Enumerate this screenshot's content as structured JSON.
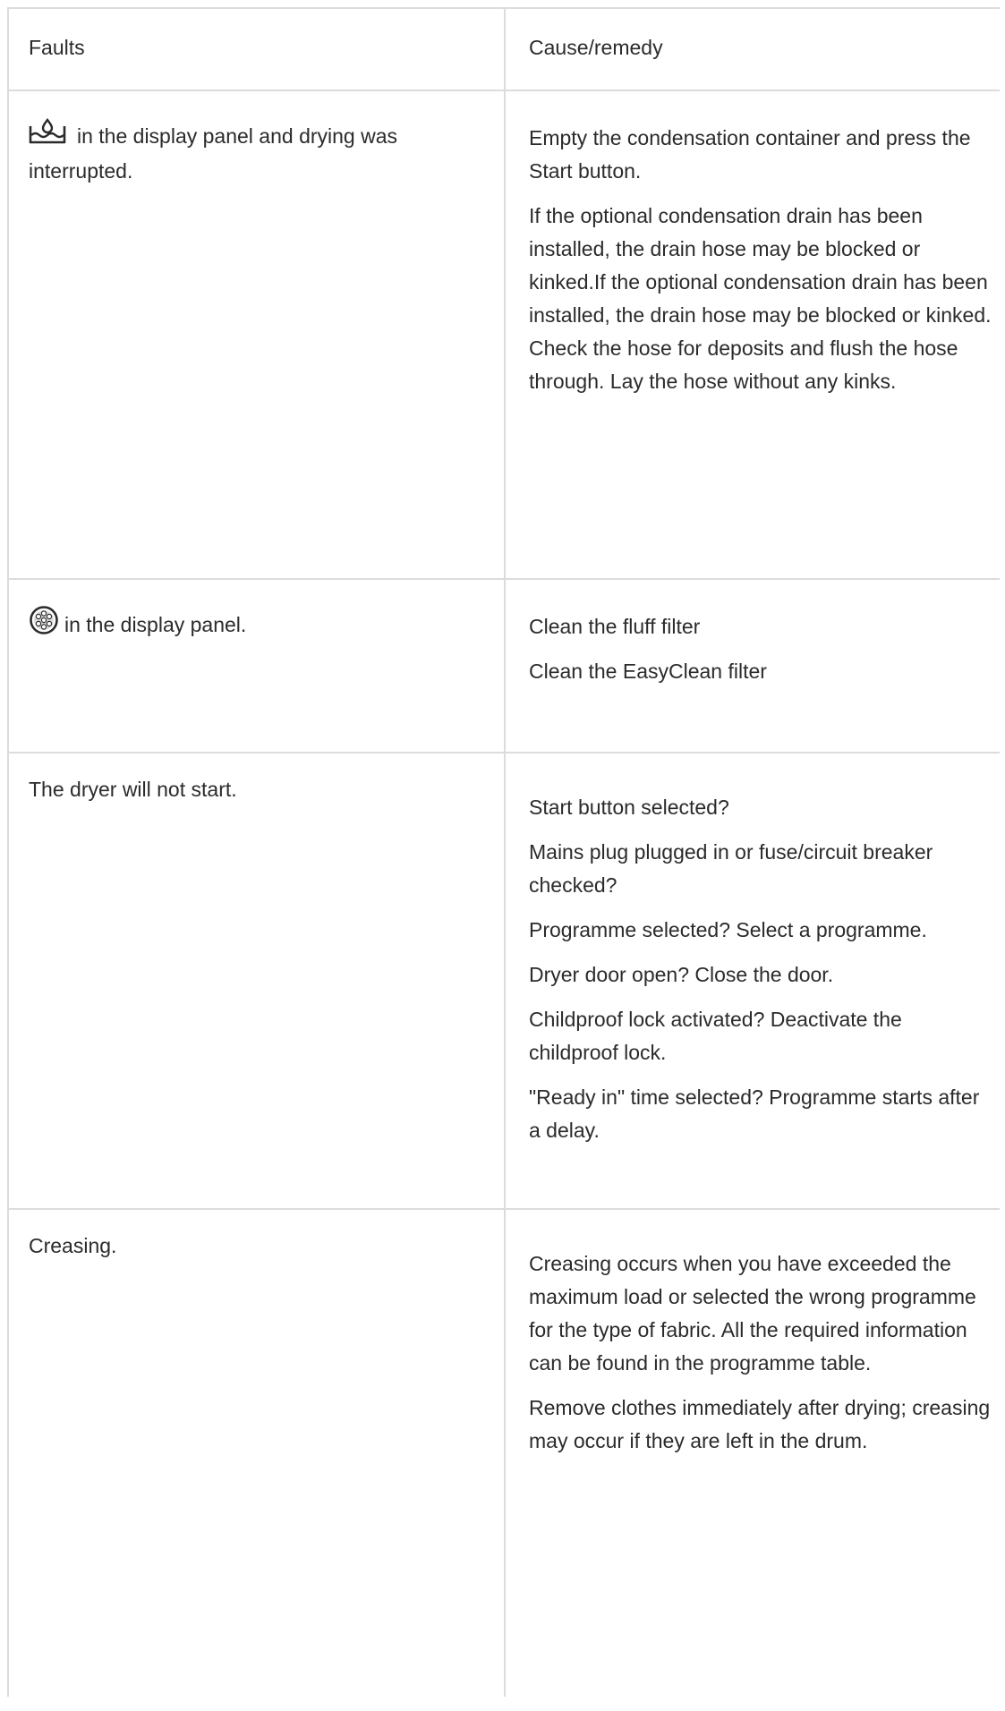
{
  "table": {
    "headers": {
      "fault": "Faults",
      "remedy": "Cause/remedy"
    },
    "rows": [
      {
        "fault_icon": "condensation-container-icon",
        "fault": "in the display panel and drying was interrupted.",
        "remedies": [
          "Empty the condensation container and press the Start button.",
          "If the optional condensation drain has been installed, the drain hose may be blocked or kinked.If the optional condensation drain has been installed, the drain hose may be blocked or kinked. Check the hose for deposits and flush the hose through. Lay the hose without any kinks."
        ]
      },
      {
        "fault_icon": "fluff-filter-icon",
        "fault": "in the display panel.",
        "remedies": [
          "Clean the fluff filter",
          "Clean the EasyClean filter"
        ]
      },
      {
        "fault": "The dryer will not start.",
        "remedies": [
          "Start button selected?",
          "Mains plug plugged in or fuse/circuit breaker checked?",
          "Programme selected? Select a programme.",
          "Dryer door open? Close the door.",
          "Childproof lock activated? Deactivate the childproof lock.",
          "\"Ready in\" time selected? Programme starts after a delay."
        ]
      },
      {
        "fault": "Creasing.",
        "remedies": [
          "Creasing occurs when you have exceeded the maximum load or selected the wrong programme for the type of fabric. All the required information can be found in the programme table.",
          "Remove clothes immediately after drying; creasing may occur if they are left in the drum."
        ]
      }
    ]
  },
  "colors": {
    "border": "#dcdcdc",
    "text": "#2b2b2b"
  }
}
